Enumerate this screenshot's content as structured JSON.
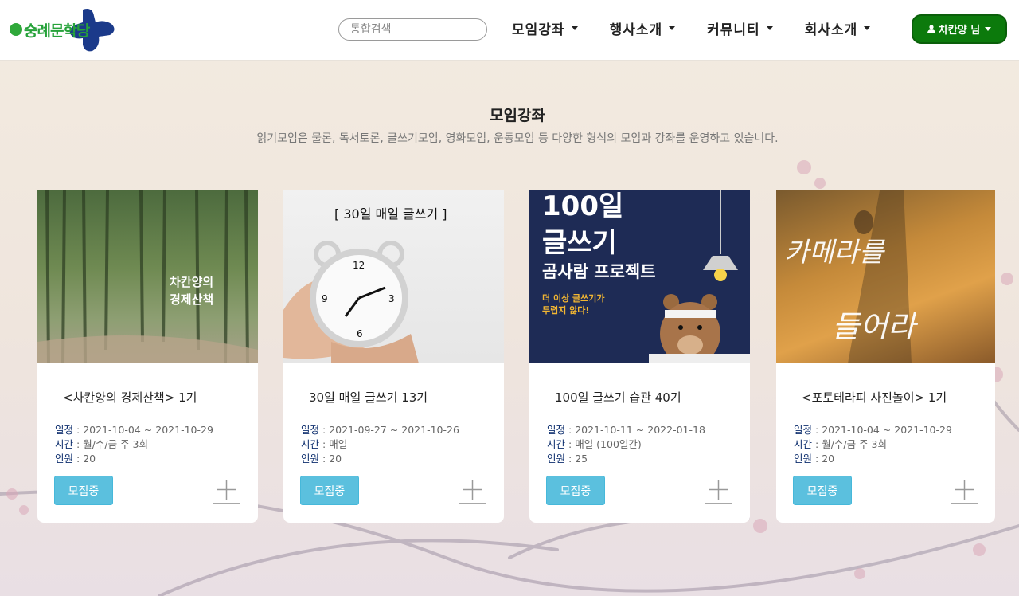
{
  "brand": {
    "logo_text": "숭례문학당"
  },
  "header": {
    "search_placeholder": "통합검색",
    "nav": [
      "모임강좌",
      "행사소개",
      "커뮤니티",
      "회사소개"
    ],
    "user_label": "차칸양 님"
  },
  "section": {
    "title": "모임강좌",
    "description": "읽기모임은 물론, 독서토론, 글쓰기모임, 영화모임, 운동모임 등 다양한 형식의 모임과 강좌를 운영하고 있습니다."
  },
  "labels": {
    "schedule": "일정",
    "time": "시간",
    "people": "인원"
  },
  "cards": [
    {
      "title": "<차칸양의 경제산책> 1기",
      "schedule": "2021-10-04 ~ 2021-10-29",
      "time": "월/수/금 주 3회",
      "people": "20",
      "status": "모집중",
      "image_text": [
        "차칸양의",
        "경제산책"
      ]
    },
    {
      "title": "30일 매일 글쓰기 13기",
      "schedule": "2021-09-27 ~ 2021-10-26",
      "time": "매일",
      "people": "20",
      "status": "모집중",
      "image_text": [
        "[ 30일 매일 글쓰기 ]"
      ]
    },
    {
      "title": "100일 글쓰기 습관 40기",
      "schedule": "2021-10-11 ~ 2022-01-18",
      "time": "매일 (100일간)",
      "people": "25",
      "status": "모집중",
      "image_text": [
        "100일",
        "글쓰기",
        "곰사람 프로젝트",
        "더 이상 글쓰기가",
        "두렵지 않다!"
      ]
    },
    {
      "title": "<포토테라피 사진놀이> 1기",
      "schedule": "2021-10-04 ~ 2021-10-29",
      "time": "월/수/금 주 3회",
      "people": "20",
      "status": "모집중",
      "image_text": [
        "카메라를",
        "들어라"
      ]
    }
  ],
  "colors": {
    "brand_green": "#26a23a",
    "brand_blue": "#1b3a8a",
    "user_button": "#0c7a0c",
    "badge": "#5bc0de",
    "label_navy": "#0e2f6e"
  }
}
